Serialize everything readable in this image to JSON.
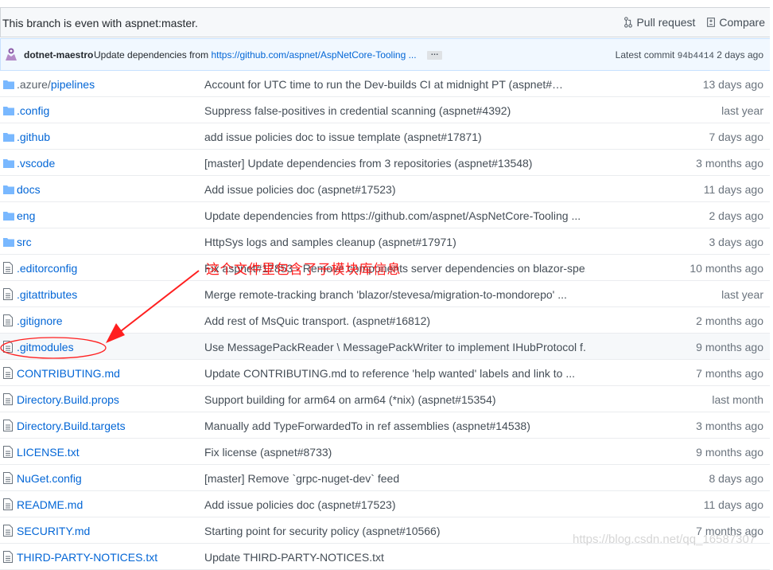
{
  "branch_status": "This branch is even with aspnet:master.",
  "actions": {
    "pull_request": "Pull request",
    "compare": "Compare"
  },
  "commit": {
    "author": "dotnet-maestro",
    "message_prefix": "Update dependencies from",
    "message_link": "https://github.com/aspnet/AspNetCore-Tooling ...",
    "ellipsis": "…",
    "latest_label": "Latest commit",
    "sha": "94b4414",
    "age": "2 days ago"
  },
  "files": [
    {
      "name": ".azure/",
      "name_sub": "pipelines",
      "type": "dir",
      "message": "Account for UTC time to run the Dev-builds CI at midnight PT (aspnet#…",
      "age": "13 days ago"
    },
    {
      "name": ".config",
      "type": "dir",
      "message": "Suppress false-positives in credential scanning (aspnet#4392)",
      "age": "last year"
    },
    {
      "name": ".github",
      "type": "dir",
      "message": "add issue policies doc to issue template (aspnet#17871)",
      "age": "7 days ago"
    },
    {
      "name": ".vscode",
      "type": "dir",
      "message": "[master] Update dependencies from 3 repositories (aspnet#13548)",
      "age": "3 months ago"
    },
    {
      "name": "docs",
      "type": "dir",
      "message": "Add issue policies doc (aspnet#17523)",
      "age": "11 days ago"
    },
    {
      "name": "eng",
      "type": "dir",
      "message": "Update dependencies from https://github.com/aspnet/AspNetCore-Tooling ...",
      "age": "2 days ago"
    },
    {
      "name": "src",
      "type": "dir",
      "message": "HttpSys logs and samples cleanup (aspnet#17971)",
      "age": "3 days ago"
    },
    {
      "name": ".editorconfig",
      "type": "file",
      "message": "Fix aspnet#17853 - Remove components server dependencies on blazor-spe...",
      "age": "10 months ago"
    },
    {
      "name": ".gitattributes",
      "type": "file",
      "message": "Merge remote-tracking branch 'blazor/stevesa/migration-to-mondorepo' ...",
      "age": "last year"
    },
    {
      "name": ".gitignore",
      "type": "file",
      "message": "Add rest of MsQuic transport. (aspnet#16812)",
      "age": "2 months ago"
    },
    {
      "name": ".gitmodules",
      "type": "file",
      "message": "Use MessagePackReader \\ MessagePackWriter to implement IHubProtocol f...",
      "age": "9 months ago",
      "highlight": true
    },
    {
      "name": "CONTRIBUTING.md",
      "type": "file",
      "message": "Update CONTRIBUTING.md to reference 'help wanted' labels and link to ...",
      "age": "7 months ago"
    },
    {
      "name": "Directory.Build.props",
      "type": "file",
      "message": "Support building for arm64 on arm64 (*nix) (aspnet#15354)",
      "age": "last month"
    },
    {
      "name": "Directory.Build.targets",
      "type": "file",
      "message": "Manually add TypeForwardedTo in ref assemblies (aspnet#14538)",
      "age": "3 months ago"
    },
    {
      "name": "LICENSE.txt",
      "type": "file",
      "message": "Fix license (aspnet#8733)",
      "age": "9 months ago"
    },
    {
      "name": "NuGet.config",
      "type": "file",
      "message": "[master] Remove `grpc-nuget-dev` feed",
      "age": "8 days ago"
    },
    {
      "name": "README.md",
      "type": "file",
      "message": "Add issue policies doc (aspnet#17523)",
      "age": "11 days ago"
    },
    {
      "name": "SECURITY.md",
      "type": "file",
      "message": "Starting point for security policy (aspnet#10566)",
      "age": "7 months ago"
    },
    {
      "name": "THIRD-PARTY-NOTICES.txt",
      "type": "file",
      "message": "Update THIRD-PARTY-NOTICES.txt",
      "age": ""
    }
  ],
  "annotation": {
    "text": "这个文件里包含了子模块库信息",
    "color": "#ff1f1f"
  },
  "watermark": "https://blog.csdn.net/qq_16587307",
  "colors": {
    "link": "#0366d6",
    "folder": "#79b8ff",
    "file_icon": "#6a737d",
    "annotation": "#ff1f1f"
  },
  "icons": {
    "folder": "folder-icon",
    "file": "file-icon",
    "pull_request": "git-pull-request-icon",
    "compare": "git-compare-icon"
  }
}
